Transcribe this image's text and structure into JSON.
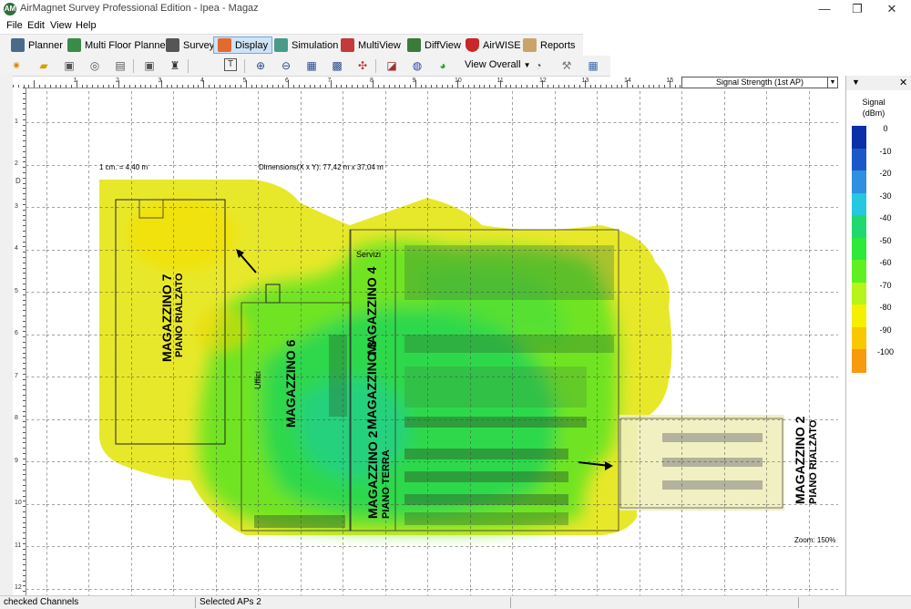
{
  "window": {
    "title": "AirMagnet Survey Professional Edition - Ipea - Magaz",
    "app_icon": "airmagnet-logo-icon",
    "controls": [
      "minimize-icon",
      "maximize-icon",
      "close-icon"
    ],
    "glyphs": {
      "minimize": "—",
      "maximize": "❐",
      "close": "✕"
    }
  },
  "menu": {
    "items": [
      "File",
      "Edit",
      "View",
      "Help"
    ]
  },
  "toolbar1": {
    "buttons": [
      {
        "label": "Planner",
        "icon": "planner-icon",
        "active": false
      },
      {
        "label": "Multi Floor Planner",
        "icon": "multi-floor-icon",
        "active": false
      },
      {
        "label": "Survey",
        "icon": "survey-walker-icon",
        "active": false
      },
      {
        "label": "Display",
        "icon": "display-icon",
        "active": true
      },
      {
        "label": "Simulation",
        "icon": "simulation-icon",
        "active": false
      },
      {
        "label": "MultiView",
        "icon": "multiview-icon",
        "active": false
      },
      {
        "label": "DiffView",
        "icon": "diffview-icon",
        "active": false
      },
      {
        "label": "AirWISE",
        "icon": "airwise-shield-icon",
        "active": false
      },
      {
        "label": "Reports",
        "icon": "reports-clipboard-icon",
        "active": false
      }
    ]
  },
  "toolbar2": {
    "view_overall_label": "View Overall",
    "icons": [
      "wand-icon",
      "open-folder-icon",
      "save-icon",
      "target-icon",
      "print-icon",
      "floppy-icon",
      "walker-icon",
      "text-tool-icon",
      "zoom-in-icon",
      "zoom-out-icon",
      "zoom-fit-icon",
      "zoom-area-icon",
      "move-icon",
      "ruler-icon",
      "globe-icon",
      "ap-icon"
    ],
    "icons_right": [
      "gauge-icon",
      "tools-icon",
      "calculator-icon"
    ]
  },
  "canvas": {
    "scale_label": "1 cm. = 4,40 m",
    "dimensions_label": "Dimensions(X x Y): 77,42 m x 37,04 m",
    "zoom_label": "Zoom: 150%",
    "ruler_x_labels": [
      "1",
      "2",
      "3",
      "4",
      "5",
      "6",
      "7",
      "8",
      "9",
      "10",
      "11",
      "12",
      "13",
      "14",
      "15",
      "16",
      "17",
      "18",
      "19",
      "20",
      "21",
      "22",
      "23",
      "24",
      "25",
      "26"
    ],
    "ruler_y_labels": [
      "1",
      "2",
      "3",
      "4",
      "5",
      "6",
      "7",
      "8",
      "9",
      "10",
      "11",
      "12"
    ],
    "ruler_marker": "D",
    "floorplan_texts": {
      "magazzino7": "MAGAZZINO 7",
      "piano_rialzato_7": "PIANO RIALZATO",
      "magazzino6": "MAGAZZINO 6",
      "uffici": "Uffici",
      "magazzino4": "MAGAZZINO 4",
      "magazzino3": "MAGAZZINO 3",
      "magazzino2a": "MAGAZZINO 2",
      "piano_terra": "PIANO TERRA",
      "servizi": "Servizi",
      "magazzino2b": "MAGAZZINO 2",
      "piano_rialzato_2": "PIANO RIALZATO"
    }
  },
  "heatmap_selector": {
    "value": "Signal Strength (1st AP)"
  },
  "legend": {
    "title": "Signal",
    "unit": "(dBm)",
    "close_icon": "close-icon",
    "dropdown_icon": "chevron-down-icon",
    "entries": [
      {
        "label": "0",
        "color": "#0a2fa8"
      },
      {
        "label": "-10",
        "color": "#1a58c8"
      },
      {
        "label": "-20",
        "color": "#2f8fe0"
      },
      {
        "label": "-30",
        "color": "#25c8e0"
      },
      {
        "label": "-40",
        "color": "#20d870"
      },
      {
        "label": "-50",
        "color": "#2ee83a"
      },
      {
        "label": "-60",
        "color": "#60f022"
      },
      {
        "label": "-70",
        "color": "#b6f41a"
      },
      {
        "label": "-80",
        "color": "#f4f000"
      },
      {
        "label": "-90",
        "color": "#f8c800"
      },
      {
        "label": "-100",
        "color": "#f89a10"
      }
    ]
  },
  "statusbar": {
    "checked_channels": "checked Channels",
    "selected_aps": "Selected APs 2"
  }
}
